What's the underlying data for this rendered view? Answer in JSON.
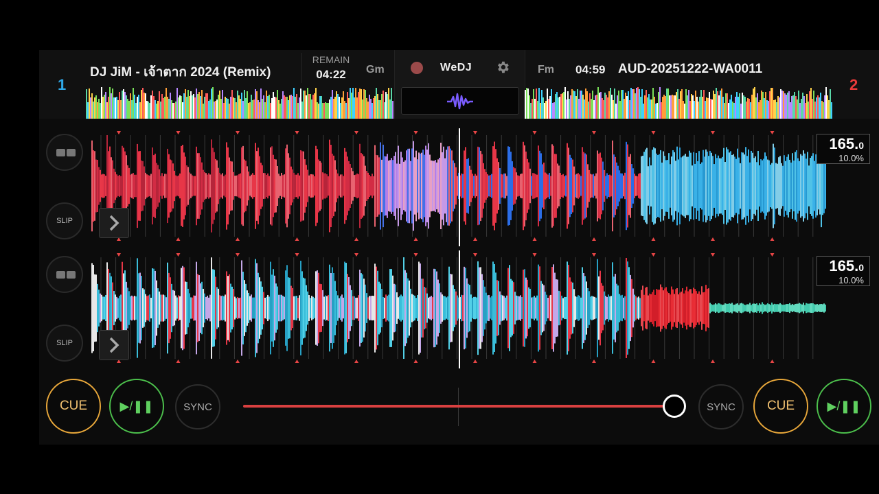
{
  "deck1": {
    "number": "1",
    "title": "DJ JiM - เจ้าตาก 2024 (Remix)",
    "remain_label": "REMAIN",
    "remain_time": "04:22",
    "key": "Gm",
    "bpm_int": "165.",
    "bpm_dec": "0",
    "pitch": "10.0%",
    "slip_label": "SLIP",
    "cue_label": "CUE",
    "sync_label": "SYNC",
    "play_label": "▶/❚❚"
  },
  "deck2": {
    "number": "2",
    "title": "AUD-20251222-WA0011",
    "time": "04:59",
    "key": "Fm",
    "bpm_int": "165.",
    "bpm_dec": "0",
    "pitch": "10.0%",
    "slip_label": "SLIP",
    "cue_label": "CUE",
    "sync_label": "SYNC",
    "play_label": "▶/❚❚"
  },
  "center": {
    "brand": "WeDJ"
  },
  "crossfader": {
    "position": 0.98
  },
  "colors": {
    "deck1_accent": "#2fa8e8",
    "deck2_accent": "#e83a3a",
    "cue": "#e8a73a",
    "play": "#4cc04c",
    "crossfader": "#d94040"
  },
  "icons": [
    "record-icon",
    "gear-icon",
    "waveform-icon",
    "chevron-right-icon",
    "layout-icon",
    "play-pause-icon"
  ]
}
